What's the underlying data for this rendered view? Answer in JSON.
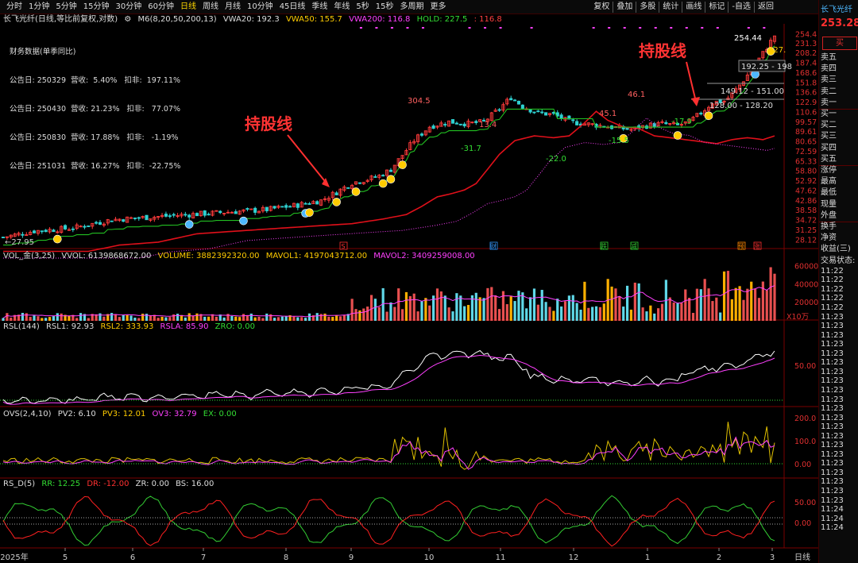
{
  "toolbar": {
    "periods": [
      "分时",
      "1分钟",
      "5分钟",
      "15分钟",
      "30分钟",
      "60分钟",
      "日线",
      "周线",
      "月线",
      "10分钟",
      "45日线",
      "季线",
      "年线",
      "5秒",
      "15秒",
      "多周期",
      "更多"
    ],
    "active_period": "日线",
    "right_menu": [
      "复权",
      "叠加",
      "多股",
      "统计",
      "画线",
      "标记",
      "-自选",
      "返回"
    ]
  },
  "legend": {
    "title": "长飞光纤(日线,等比前复权,对数)",
    "ma": "M6(8,20,50,200,13)",
    "vwa20": "VWA20: 192.3",
    "vwa50": "VWA50: 155.7",
    "vwa200": "VWA200: 116.8",
    "hold": "HOLD: 227.5",
    "hold2": ": 116.8"
  },
  "financial": {
    "header": "财务数据(单季同比)",
    "rows": [
      "公告日: 250329  营收:  5.40%   扣非:  197.11%",
      "公告日: 250430  营收: 21.23%   扣非:   77.07%",
      "公告日: 250830  营收: 17.88%   扣非:   -1.19%",
      "公告日: 251031  营收: 16.27%   扣非:  -22.75%"
    ]
  },
  "annotations": {
    "hold_line_1": "持股线",
    "hold_line_2": "持股线"
  },
  "price_labels": {
    "low_left": "←27.95",
    "p304": "304.5",
    "p13": "13.4",
    "m31": "-31.7",
    "m22": "-22.0",
    "p45": "45.1",
    "m15": "-15.5",
    "p46": "46.1",
    "m17": "-17.9",
    "p254": "254.44",
    "p227": "227.",
    "r192": "192.25 - 198",
    "r149": "149.12 - 151.00",
    "r128": "128.00 - 128.20"
  },
  "price_axis": [
    "254.4",
    "231.3",
    "208.2",
    "187.4",
    "168.6",
    "151.8",
    "136.6",
    "122.9",
    "110.6",
    "99.57",
    "89.61",
    "80.65",
    "72.59",
    "65.33",
    "58.80",
    "52.92",
    "47.62",
    "42.86",
    "38.58",
    "34.72",
    "31.25",
    "28.12"
  ],
  "event_markers": [
    {
      "label": "S",
      "color": "#ff3030"
    },
    {
      "label": "财",
      "color": "#3399ff"
    },
    {
      "label": "跌",
      "color": "#33cc33"
    },
    {
      "label": "减",
      "color": "#33cc33"
    },
    {
      "label": "预",
      "color": "#ff8800"
    },
    {
      "label": "涨",
      "color": "#ff3030"
    }
  ],
  "vol_panel": {
    "name": "VOL_金(3,25)",
    "vvol": "VVOL: 6139868672.00",
    "volume": "VOLUME: 3882392320.00",
    "mavol1": "MAVOL1: 4197043712.00",
    "mavol2": "MAVOL2: 3409259008.00",
    "axis": [
      "60000",
      "40000",
      "20000"
    ],
    "unit": "X10万"
  },
  "rsl_panel": {
    "name": "RSL(144)",
    "rsl1": "RSL1: 92.93",
    "rsl2": "RSL2: 333.93",
    "rsla": "RSLA: 85.90",
    "zro": "ZRO: 0.00",
    "axis": [
      "50.00"
    ]
  },
  "ovs_panel": {
    "name": "OVS(2,4,10)",
    "pv2": "PV2: 6.10",
    "pv3": "PV3: 12.01",
    "ov3": "OV3: 32.79",
    "ex": "EX: 0.00",
    "axis": [
      "200.0",
      "100.0",
      "0.00"
    ]
  },
  "rsd_panel": {
    "name": "RS_D(5)",
    "rr": "RR: 12.25",
    "dr": "DR: -12.00",
    "zr": "ZR: 0.00",
    "bs": "BS: 16.00",
    "axis": [
      "50.00",
      "0.00"
    ]
  },
  "time_axis": [
    "2025年",
    "5",
    "6",
    "7",
    "8",
    "9",
    "10",
    "11",
    "12",
    "1",
    "2",
    "3"
  ],
  "time_axis_right": "日线",
  "side_panel": {
    "stock_name": "长飞光纤",
    "price": "253.28",
    "buy": "买",
    "rows": [
      "卖五",
      "卖四",
      "卖三",
      "卖二",
      "卖一",
      "买一",
      "买二",
      "买三",
      "买四",
      "买五",
      "涨停",
      "最高",
      "最低",
      "现量",
      "外盘",
      "换手",
      "净资",
      "收益(三)",
      "交易状态:"
    ],
    "times": [
      "11:22",
      "11:22",
      "11:22",
      "11:22",
      "11:22",
      "11:23",
      "11:23",
      "11:23",
      "11:23",
      "11:23",
      "11:23",
      "11:23",
      "11:23",
      "11:23",
      "11:23",
      "11:23",
      "11:23",
      "11:23",
      "11:23",
      "11:23",
      "11:23",
      "11:23",
      "11:23",
      "11:23",
      "11:23",
      "11:23",
      "11:24",
      "11:24",
      "11:24"
    ]
  },
  "colors": {
    "up": "#ff3b3b",
    "down": "#2fd1d1",
    "ma_green": "#22c022",
    "ma_magenta": "#ff40ff",
    "red_line": "#e0101a"
  }
}
